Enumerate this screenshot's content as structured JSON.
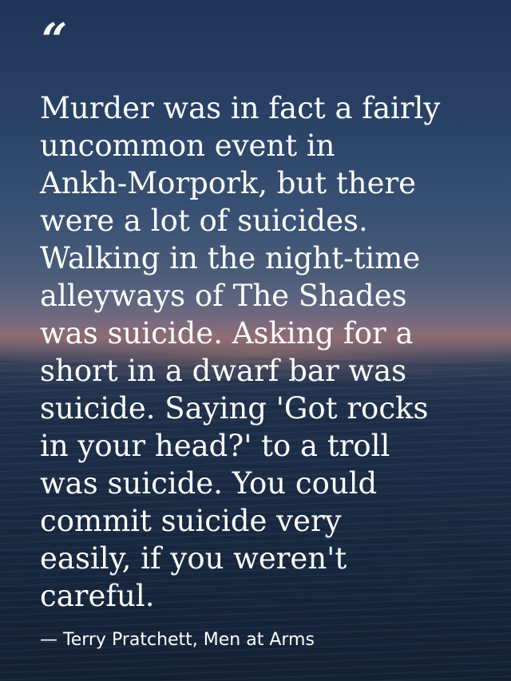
{
  "quote": {
    "mark": "“",
    "lines": [
      "Murder was in fact a fairly",
      "uncommon event in",
      "Ankh-Morpork, but there",
      "were a lot of suicides.",
      "Walking in the night-time",
      "alleyways of The Shades",
      "was suicide. Asking for a",
      "short in a dwarf bar was",
      "suicide. Saying 'Got rocks",
      "in your head?' to a troll",
      "was suicide. You could",
      "commit suicide very",
      "easily, if you weren't",
      "careful."
    ],
    "attribution": "— Terry Pratchett, Men at Arms"
  },
  "colors": {
    "text": "#ffffff",
    "sky_top": "#1f3558",
    "horizon": "#8c6c70",
    "sea": "#182840"
  },
  "icons": {
    "quote_mark": "open-quote-icon"
  }
}
